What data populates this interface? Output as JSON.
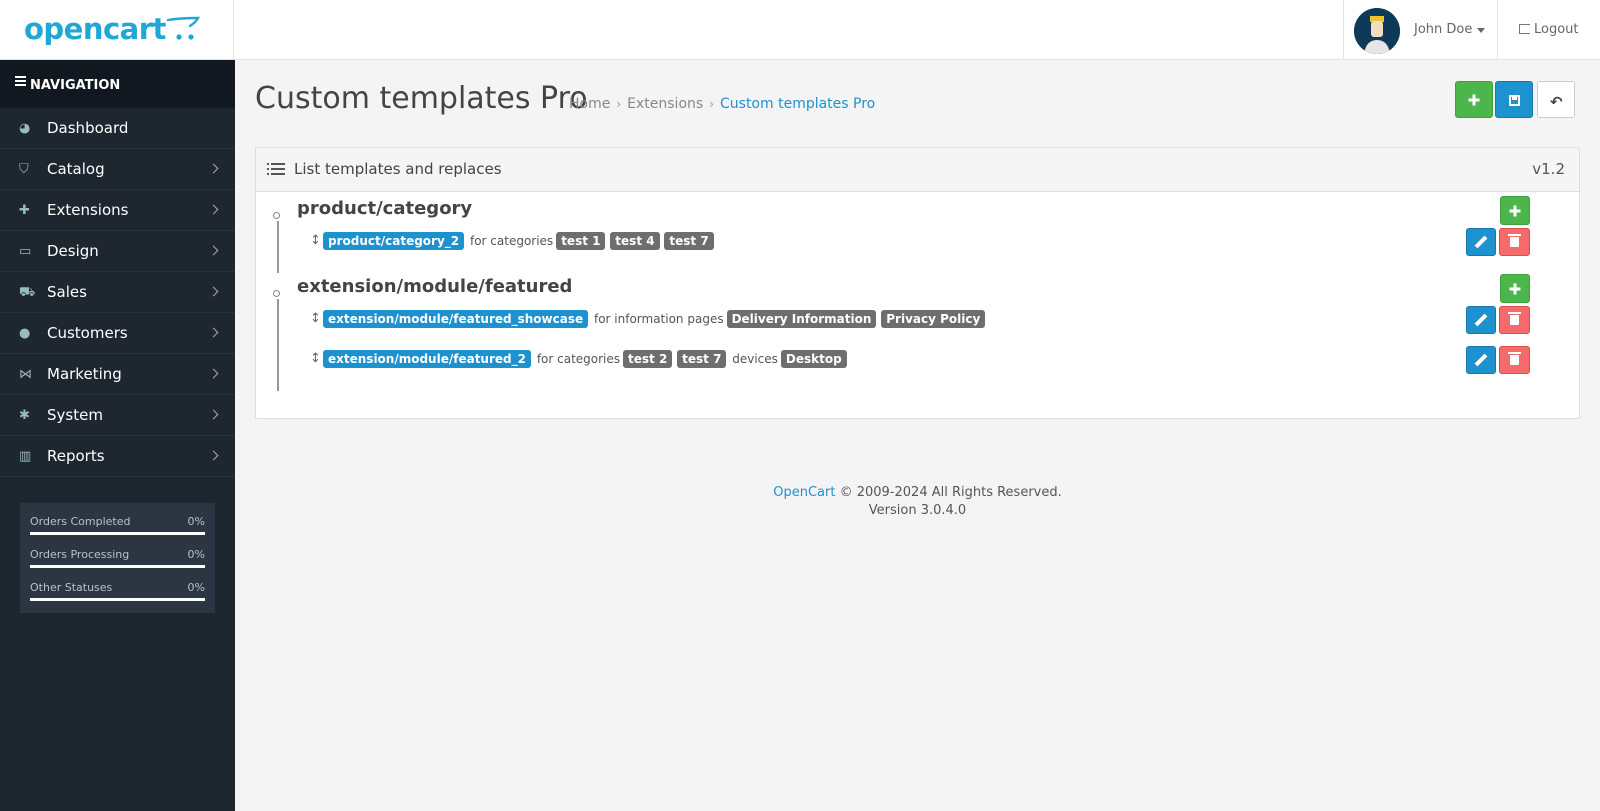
{
  "header": {
    "logo_text": "opencart",
    "user_name": "John Doe",
    "logout_label": "Logout"
  },
  "sidebar": {
    "heading": "NAVIGATION",
    "items": [
      {
        "label": "Dashboard",
        "icon": "dashboard-icon",
        "has_arrow": false
      },
      {
        "label": "Catalog",
        "icon": "tags-icon",
        "has_arrow": true
      },
      {
        "label": "Extensions",
        "icon": "puzzle-icon",
        "has_arrow": true
      },
      {
        "label": "Design",
        "icon": "desktop-icon",
        "has_arrow": true
      },
      {
        "label": "Sales",
        "icon": "cart-icon",
        "has_arrow": true
      },
      {
        "label": "Customers",
        "icon": "user-icon",
        "has_arrow": true
      },
      {
        "label": "Marketing",
        "icon": "share-icon",
        "has_arrow": true
      },
      {
        "label": "System",
        "icon": "gear-icon",
        "has_arrow": true
      },
      {
        "label": "Reports",
        "icon": "bar-chart-icon",
        "has_arrow": true
      }
    ],
    "stats": [
      {
        "label": "Orders Completed",
        "value": "0%",
        "fraction": 0
      },
      {
        "label": "Orders Processing",
        "value": "0%",
        "fraction": 0
      },
      {
        "label": "Other Statuses",
        "value": "0%",
        "fraction": 0
      }
    ]
  },
  "page": {
    "title": "Custom templates Pro",
    "breadcrumb": [
      "Home",
      "Extensions",
      "Custom templates Pro"
    ]
  },
  "panel": {
    "title": "List templates and replaces",
    "version": "v1.2",
    "groups": [
      {
        "title": "product/category",
        "rows": [
          {
            "template": "product/category_2",
            "segments": [
              {
                "text": "for categories",
                "badges": [
                  "test 1",
                  "test 4",
                  "test 7"
                ]
              }
            ]
          }
        ]
      },
      {
        "title": "extension/module/featured",
        "rows": [
          {
            "template": "extension/module/featured_showcase",
            "segments": [
              {
                "text": "for information pages",
                "badges": [
                  "Delivery Information",
                  "Privacy Policy"
                ]
              }
            ]
          },
          {
            "template": "extension/module/featured_2",
            "segments": [
              {
                "text": "for categories",
                "badges": [
                  "test 2",
                  "test 7"
                ]
              },
              {
                "text": "devices",
                "badges": [
                  "Desktop"
                ]
              }
            ]
          }
        ]
      }
    ]
  },
  "footer": {
    "link": "OpenCart",
    "copyright": "© 2009-2024 All Rights Reserved.",
    "version": "Version 3.0.4.0"
  },
  "colors": {
    "primary": "#1e91cf",
    "success": "#4cb64c",
    "danger": "#f56b6b",
    "sidebar": "#1e2630",
    "logo": "#1fa7d6"
  }
}
